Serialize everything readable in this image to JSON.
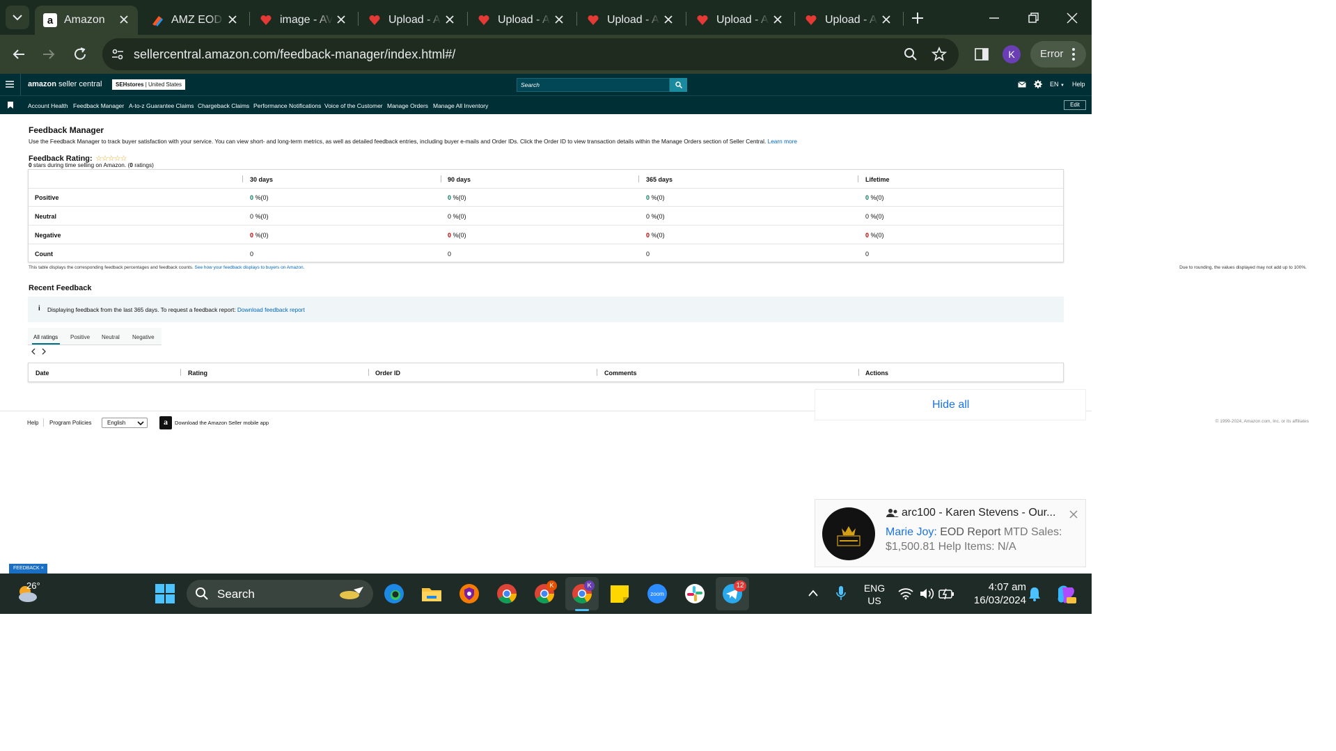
{
  "browser": {
    "tabs": [
      {
        "title": "Amazon",
        "active": true,
        "favicon": "amazon-a-icon"
      },
      {
        "title": "AMZ EOD",
        "active": false,
        "favicon": "colorful-pen-icon"
      },
      {
        "title": "image - AV",
        "active": false,
        "favicon": "heart-logo-icon"
      },
      {
        "title": "Upload - A",
        "active": false,
        "favicon": "heart-logo-icon"
      },
      {
        "title": "Upload - A",
        "active": false,
        "favicon": "heart-logo-icon"
      },
      {
        "title": "Upload - A",
        "active": false,
        "favicon": "heart-logo-icon"
      },
      {
        "title": "Upload - A",
        "active": false,
        "favicon": "heart-logo-icon"
      },
      {
        "title": "Upload - A",
        "active": false,
        "favicon": "heart-logo-icon"
      }
    ],
    "url": "sellercentral.amazon.com/feedback-manager/index.html#/",
    "profile_initial": "K",
    "error_label": "Error"
  },
  "header": {
    "logo_text_bold": "amazon",
    "logo_text_light": "seller central",
    "store_name": "SEHstores",
    "store_region": "United States",
    "search_placeholder": "Search",
    "language": "EN",
    "help": "Help",
    "edit": "Edit"
  },
  "nav": [
    "Account Health",
    "Feedback Manager",
    "A-to-z Guarantee Claims",
    "Chargeback Claims",
    "Performance Notifications",
    "Voice of the Customer",
    "Manage Orders",
    "Manage All Inventory"
  ],
  "page": {
    "title": "Feedback Manager",
    "description": "Use the Feedback Manager to track buyer satisfaction with your service. You can view short- and long-term metrics, as well as detailed feedback entries, including buyer e-mails and Order IDs. Click the Order ID to view transaction details within the Manage Orders section of Seller Central.",
    "learn_more": "Learn more",
    "rating_label": "Feedback Rating:",
    "stars_value": 0,
    "stars_max": 5,
    "rating_summary_stars": "0",
    "rating_summary_mid": " stars during time selling on Amazon. (",
    "rating_summary_count": "0",
    "rating_summary_end": " ratings)"
  },
  "metrics_table": {
    "columns": [
      "30 days",
      "90 days",
      "365 days",
      "Lifetime"
    ],
    "rows": [
      {
        "label": "Positive",
        "values": [
          "0",
          "0",
          "0",
          "0"
        ],
        "suffix": " %(0)",
        "color": "#067d62"
      },
      {
        "label": "Neutral",
        "values": [
          "0",
          "0",
          "0",
          "0"
        ],
        "suffix": " %(0)",
        "color": "#111111"
      },
      {
        "label": "Negative",
        "values": [
          "0",
          "0",
          "0",
          "0"
        ],
        "suffix": " %(0)",
        "color": "#c40000"
      },
      {
        "label": "Count",
        "values": [
          "0",
          "0",
          "0",
          "0"
        ],
        "suffix": "",
        "color": "#111111"
      }
    ],
    "footnote": "This table displays the corresponding feedback percentages and feedback counts.",
    "footnote_link": "See how your feedback displays to buyers on Amazon.",
    "rounding_note": "Due to rounding, the values displayed may not add up to 100%."
  },
  "recent": {
    "title": "Recent Feedback",
    "info": "Displaying feedback from the last 365 days. To request a feedback report:",
    "info_link": "Download feedback report",
    "tabs": [
      "All ratings",
      "Positive",
      "Neutral",
      "Negative"
    ],
    "columns": [
      "Date",
      "Rating",
      "Order ID",
      "Comments",
      "Actions"
    ]
  },
  "footer": {
    "help": "Help",
    "policies": "Program Policies",
    "language": "English",
    "app": "Download the Amazon Seller mobile app",
    "copyright": "© 1999-2024, Amazon.com, Inc. or its affiliates"
  },
  "overlay": {
    "hide_all": "Hide all",
    "feedback_tab": "FEEDBACK"
  },
  "notification": {
    "title": "arc100 - Karen Stevens - Our...",
    "sender": "Marie Joy:",
    "subject": "EOD Report",
    "body_1": "MTD Sales:",
    "body_2": "$1,500.81 Help Items: N/A"
  },
  "taskbar": {
    "weather": "26°",
    "search": "Search",
    "lang_1": "ENG",
    "lang_2": "US",
    "time": "4:07 am",
    "date": "16/03/2024",
    "telegram_badge": "12",
    "chrome_badge_1": "K",
    "chrome_badge_2": "K"
  }
}
